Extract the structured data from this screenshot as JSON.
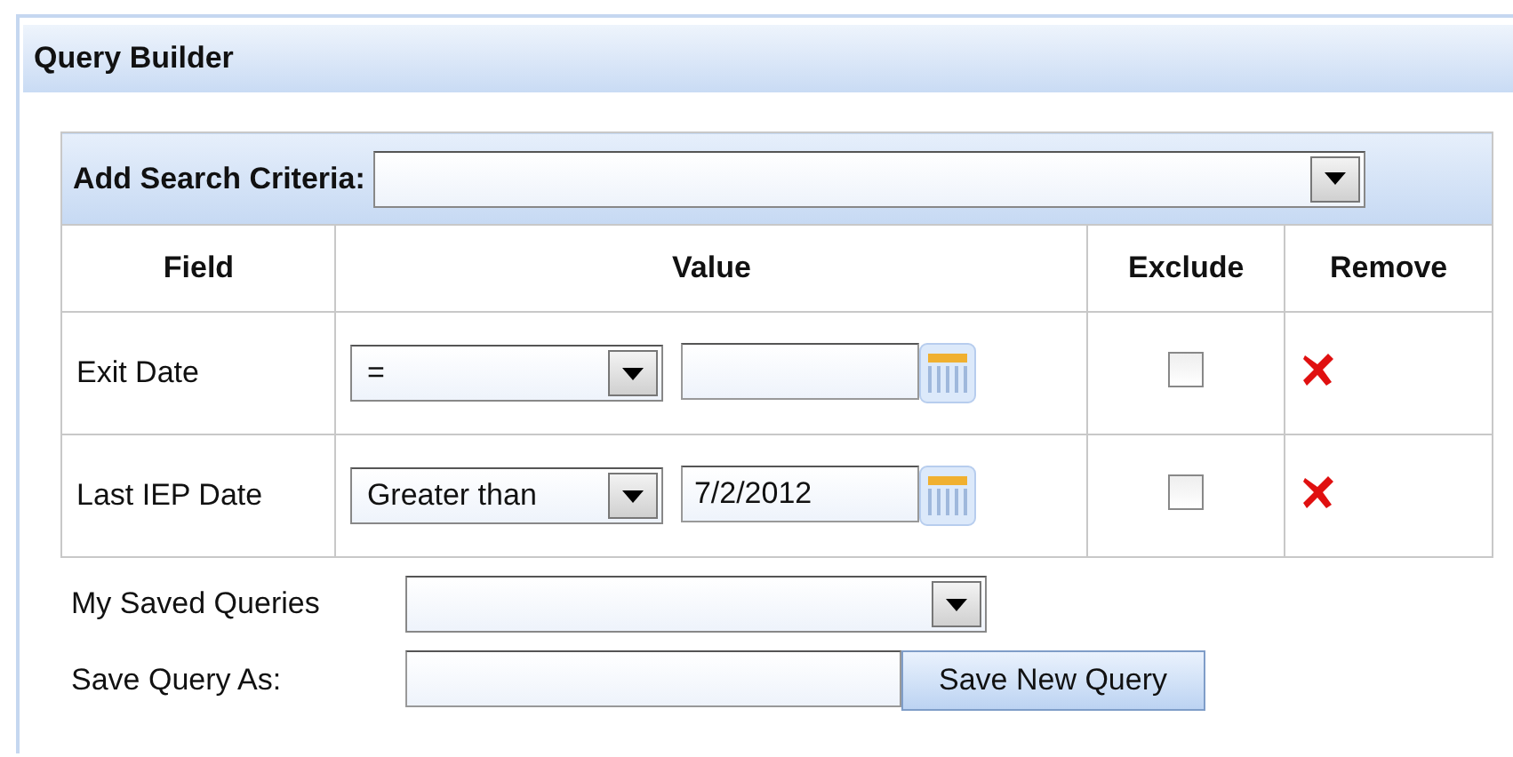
{
  "panel": {
    "title": "Query Builder"
  },
  "criteria": {
    "label": "Add Search Criteria:"
  },
  "table": {
    "columns": [
      "Field",
      "Value",
      "Exclude",
      "Remove"
    ],
    "rows": [
      {
        "field": "Exit Date",
        "operator": "=",
        "value": "",
        "exclude": false
      },
      {
        "field": "Last IEP Date",
        "operator": "Greater than",
        "value": "7/2/2012",
        "exclude": false
      }
    ]
  },
  "saved_queries": {
    "label": "My Saved Queries"
  },
  "save_as": {
    "label": "Save Query As:",
    "button": "Save New Query"
  }
}
